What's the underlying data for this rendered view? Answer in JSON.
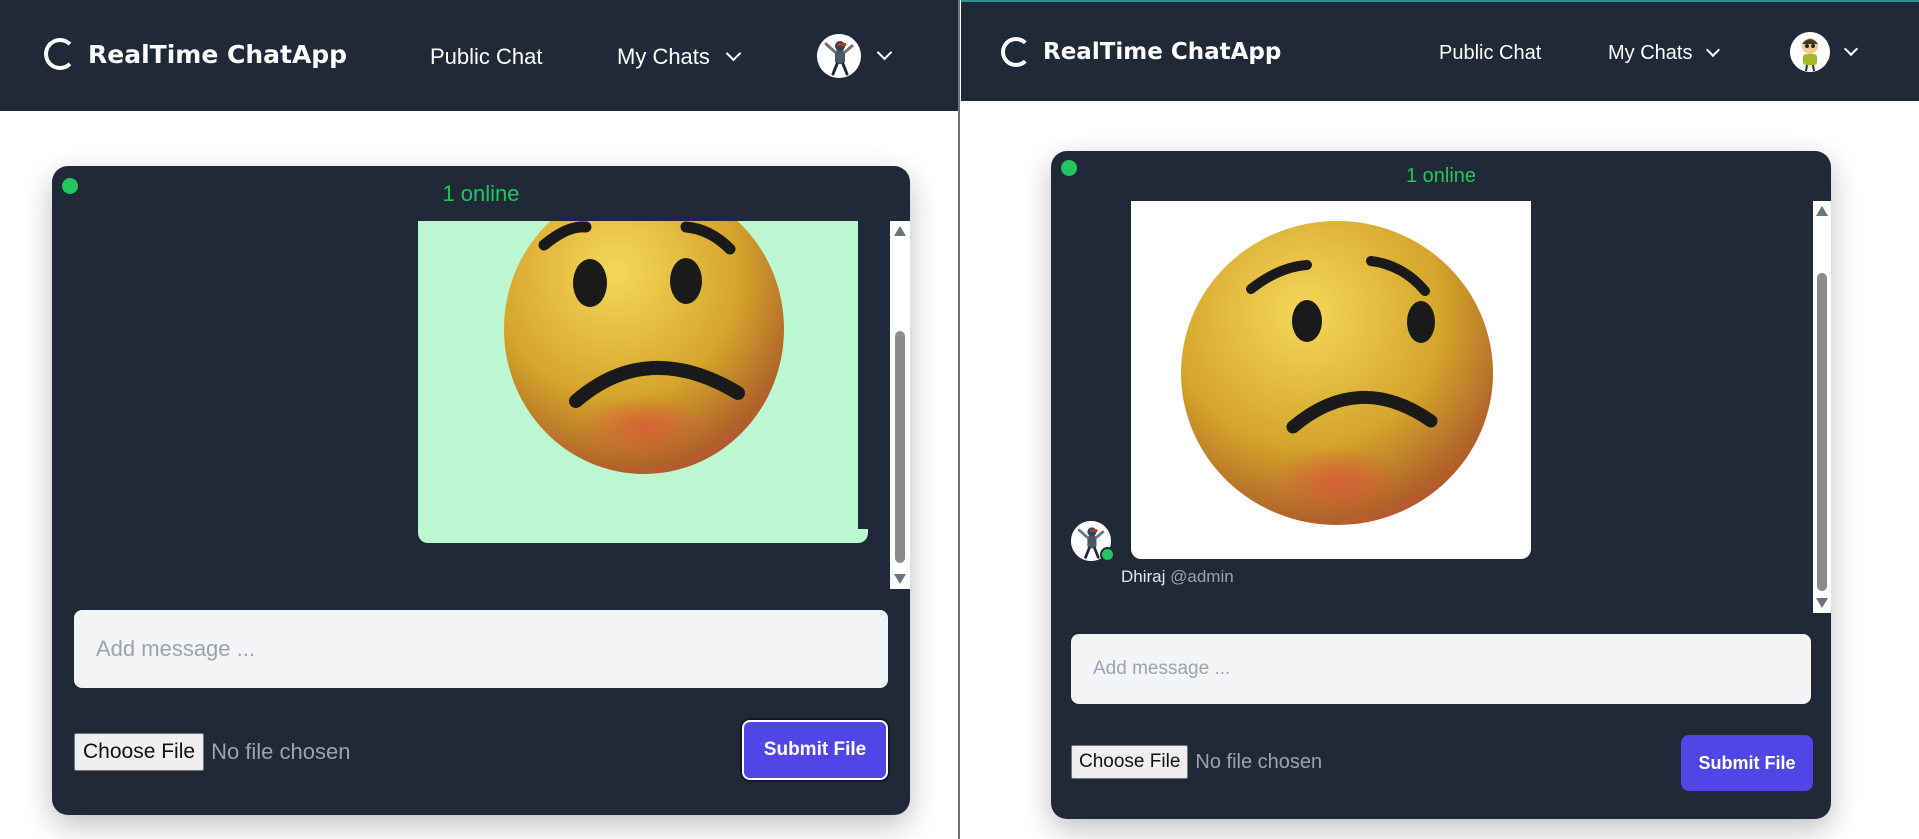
{
  "left_window": {
    "brand": "RealTime ChatApp",
    "nav": {
      "public_chat": "Public Chat",
      "my_chats": "My Chats"
    },
    "chat": {
      "online_text": "1 online"
    },
    "composer": {
      "placeholder": "Add message ...",
      "choose_file": "Choose File",
      "file_status": "No file chosen",
      "submit": "Submit File"
    }
  },
  "right_window": {
    "brand": "RealTime ChatApp",
    "nav": {
      "public_chat": "Public Chat",
      "my_chats": "My Chats"
    },
    "chat": {
      "online_text": "1 online",
      "message": {
        "sender_name": "Dhiraj",
        "sender_handle": "@admin"
      }
    },
    "composer": {
      "placeholder": "Add message ...",
      "choose_file": "Choose File",
      "file_status": "No file chosen",
      "submit": "Submit File"
    }
  },
  "icons": {
    "brand_logo": "ring-logo-icon",
    "dropdown": "chevron-down-icon",
    "message_image": "worried-face-emoji",
    "avatar_left": "dabbing-user-avatar",
    "avatar_right": "cartoon-user-avatar"
  },
  "colors": {
    "navbar": "#1f2937",
    "card": "#1f2937",
    "online": "#22c55e",
    "bubble_sent": "#bbf7d0",
    "accent": "#4f46e5",
    "input_bg": "#f3f4f6"
  }
}
